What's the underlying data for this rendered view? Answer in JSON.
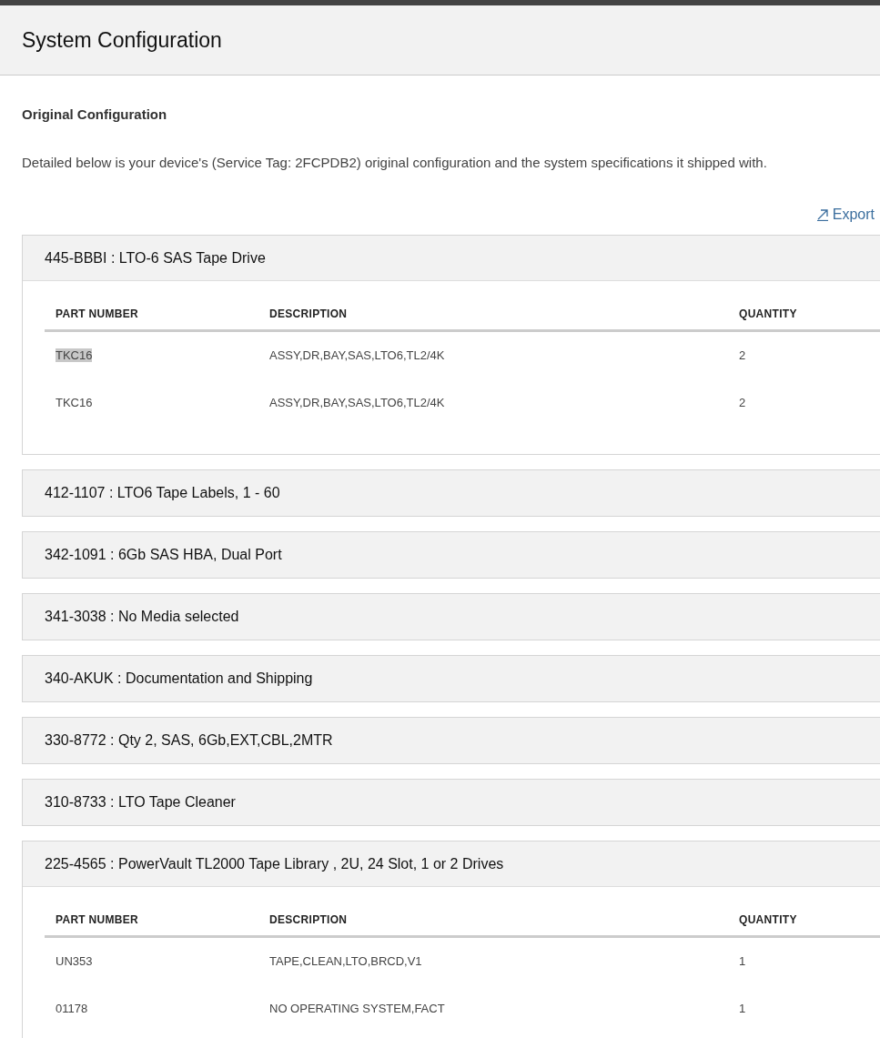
{
  "page_title": "System Configuration",
  "section_title": "Original Configuration",
  "intro": "Detailed below is your device's (Service Tag: 2FCPDB2) original configuration and the system specifications it shipped with.",
  "export_link": "Export",
  "groups": [
    {
      "title": "445-BBBI : LTO-6 SAS Tape Drive",
      "expanded": true,
      "columns": [
        "PART NUMBER",
        "DESCRIPTION",
        "QUANTITY"
      ],
      "rows": [
        {
          "part": "TKC16",
          "description": "ASSY,DR,BAY,SAS,LTO6,TL2/4K",
          "quantity": "2",
          "highlighted": true
        },
        {
          "part": "TKC16",
          "description": "ASSY,DR,BAY,SAS,LTO6,TL2/4K",
          "quantity": "2",
          "highlighted": false
        }
      ]
    },
    {
      "title": "412-1107 : LTO6 Tape Labels, 1 - 60",
      "expanded": false
    },
    {
      "title": "342-1091 : 6Gb SAS HBA, Dual Port",
      "expanded": false
    },
    {
      "title": "341-3038 : No Media selected",
      "expanded": false
    },
    {
      "title": "340-AKUK : Documentation and Shipping",
      "expanded": false
    },
    {
      "title": "330-8772 : Qty 2, SAS, 6Gb,EXT,CBL,2MTR",
      "expanded": false
    },
    {
      "title": "310-8733 : LTO Tape Cleaner",
      "expanded": false
    },
    {
      "title": "225-4565 : PowerVault TL2000 Tape Library , 2U, 24 Slot, 1 or 2 Drives",
      "expanded": true,
      "columns": [
        "PART NUMBER",
        "DESCRIPTION",
        "QUANTITY"
      ],
      "rows": [
        {
          "part": "UN353",
          "description": "TAPE,CLEAN,LTO,BRCD,V1",
          "quantity": "1",
          "highlighted": false
        },
        {
          "part": "01178",
          "description": "NO OPERATING SYSTEM,FACT",
          "quantity": "1",
          "highlighted": false
        }
      ]
    }
  ]
}
